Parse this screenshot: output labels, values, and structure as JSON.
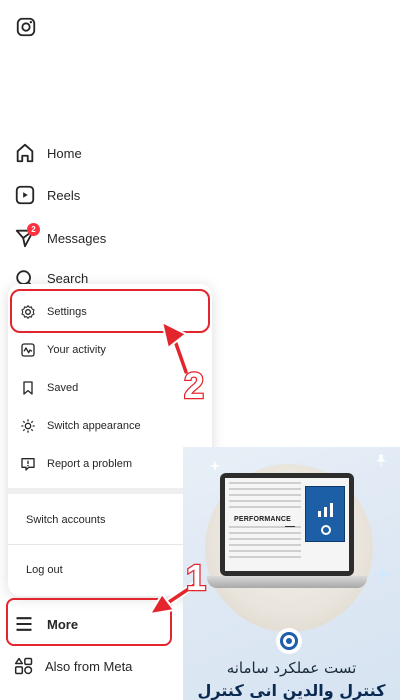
{
  "nav": {
    "home": "Home",
    "reels": "Reels",
    "messages": "Messages",
    "messages_badge": "2",
    "search": "Search",
    "more": "More",
    "also_from_meta": "Also from Meta"
  },
  "menu": {
    "settings": "Settings",
    "your_activity": "Your activity",
    "saved": "Saved",
    "switch_appearance": "Switch appearance",
    "report_problem": "Report a problem",
    "switch_accounts": "Switch accounts",
    "log_out": "Log out"
  },
  "annotations": {
    "step1": "1",
    "step2": "2",
    "highlight_color": "#e3262d"
  },
  "ad": {
    "screen_label": "PERFORMANCE",
    "line1": "تست عملکرد سامانه",
    "line2": "کنترل والدین انی کنترل"
  },
  "icons": [
    "instagram-icon",
    "home-icon",
    "reels-icon",
    "messages-icon",
    "search-icon",
    "hamburger-icon",
    "meta-apps-icon",
    "settings-icon",
    "activity-icon",
    "saved-icon",
    "appearance-icon",
    "report-icon",
    "pin-icon"
  ]
}
